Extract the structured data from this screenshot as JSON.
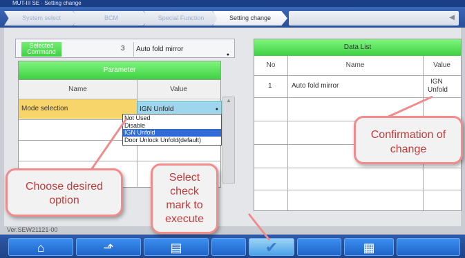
{
  "window": {
    "title": "MUT-III SE · Setting change"
  },
  "tabs": [
    {
      "label": "System select"
    },
    {
      "label": "BCM"
    },
    {
      "label": "Special Function"
    },
    {
      "label": "Setting change"
    }
  ],
  "selected_command": {
    "label": "Selected Command",
    "number": "3",
    "value": "Auto fold mirror"
  },
  "parameter": {
    "title": "Parameter",
    "col_name": "Name",
    "col_value": "Value",
    "row_name": "Mode selection",
    "row_value": "IGN Unfold"
  },
  "dropdown_options": [
    {
      "label": "Not Used"
    },
    {
      "label": "Disable"
    },
    {
      "label": "IGN Unfold"
    },
    {
      "label": "Door Unlock Unfold(default)"
    }
  ],
  "data_list": {
    "title": "Data List",
    "col_no": "No",
    "col_name": "Name",
    "col_value": "Value",
    "rows": [
      {
        "no": "1",
        "name": "Auto fold mirror",
        "value_line1": "IGN",
        "value_line2": "Unfold"
      }
    ]
  },
  "version": "Ver.SEW21121-00",
  "callouts": {
    "choose": {
      "line1": "Choose desired",
      "line2": "option"
    },
    "select": {
      "line1": "Select",
      "line2": "check",
      "line3": "mark to",
      "line4": "execute"
    },
    "confirm": {
      "line1": "Confirmation of",
      "line2": "change"
    }
  },
  "icons": {
    "home": "home-icon",
    "back": "back-arrow-icon",
    "book": "book-icon",
    "check": "check-mark-icon",
    "data": "data-list-icon"
  },
  "colors": {
    "header_green": "#3fd042",
    "selected_yellow": "#f8d56a",
    "callout_border": "#f08c8c",
    "callout_text": "#c23a3a"
  }
}
